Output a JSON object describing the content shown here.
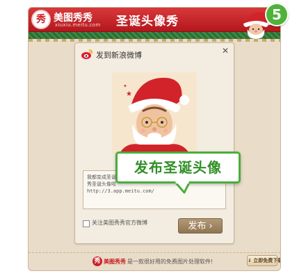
{
  "header": {
    "logo_glyph": "秀",
    "brand_name": "美图秀秀",
    "brand_domain": "xiuxiu.meitu.com",
    "title": "圣诞头像秀"
  },
  "step_badge": "5",
  "dialog": {
    "title": "发到新浪微博",
    "close_icon": "close-icon",
    "post_text": "我都变成圣诞老人了~我是用美图秀秀做的，\n秀圣诞头像啦\nhttp://3.app.meitu.com/",
    "follow_label": "关注美图秀秀官方微博",
    "follow_checked": false,
    "publish_label": "发布 ›"
  },
  "callout": {
    "text": "发布圣诞头像"
  },
  "footer": {
    "brand": "美图秀秀",
    "tagline": "是一款很好用的免费图片处理软件!",
    "download_label": "⇓ 立即免费下载"
  },
  "colors": {
    "header_red": "#c3252a",
    "callout_green": "#49ae3a",
    "panel_beige": "#e9dcc8"
  }
}
